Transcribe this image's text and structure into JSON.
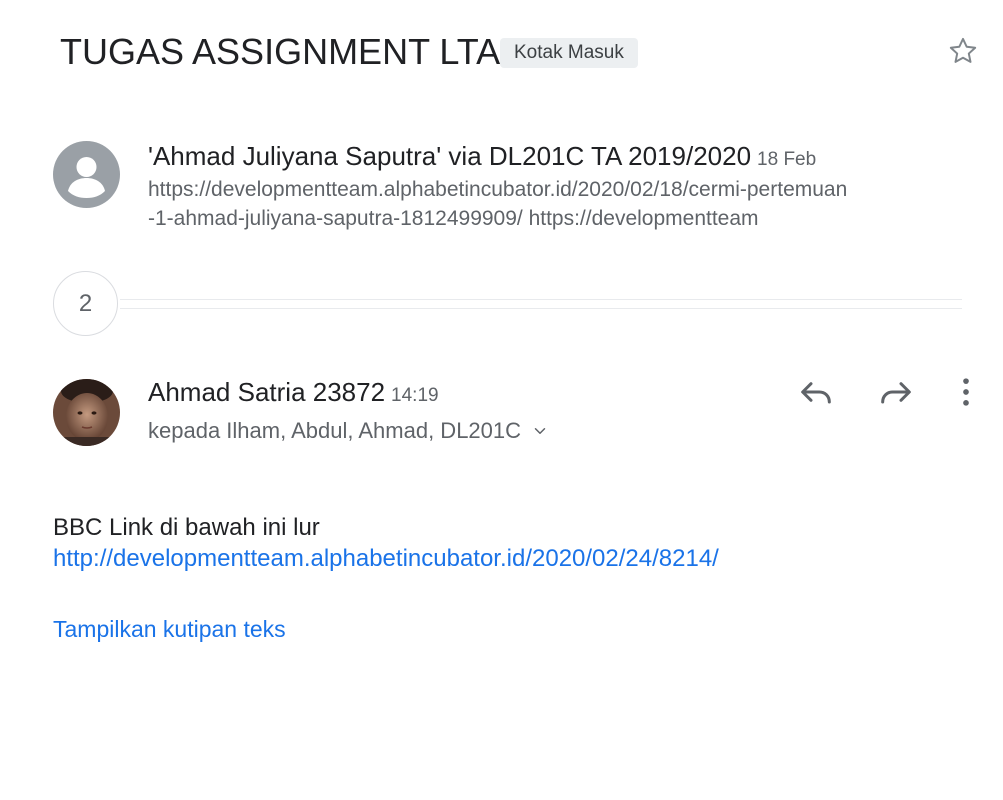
{
  "thread": {
    "subject": "TUGAS ASSIGNMENT LTAI",
    "label": "Kotak Masuk"
  },
  "collapsed_message": {
    "sender": "'Ahmad Juliyana Saputra' via DL201C TA 2019/2020",
    "date": "18 Feb",
    "snippet_lines": [
      "https://developmentteam.alphabetincubator.id/2020/02/18/cermi-pertemuan",
      "-1-ahmad-juliyana-saputra-1812499909/ https://developmentteam"
    ]
  },
  "collapsed_count": "2",
  "expanded_message": {
    "sender": "Ahmad Satria 23872",
    "time": "14:19",
    "recipients": "kepada Ilham, Abdul, Ahmad, DL201C",
    "body_text": "BBC Link di bawah ini lur",
    "body_link": "http://developmentteam.alphabetincubator.id/2020/02/24/8214/",
    "show_quoted": "Tampilkan kutipan teks"
  },
  "icons": {
    "star": "star-outline-icon",
    "reply": "reply-icon",
    "forward": "forward-icon",
    "more": "more-vert-icon",
    "expand": "chevron-down-icon",
    "default_avatar": "person-icon"
  },
  "colors": {
    "text_primary": "#202124",
    "text_secondary": "#5f6368",
    "link": "#1a73e8",
    "chip_bg": "#eceff1"
  }
}
